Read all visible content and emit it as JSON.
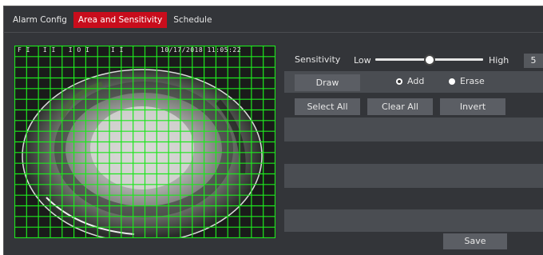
{
  "tabs": [
    {
      "label": "Alarm Config",
      "active": false
    },
    {
      "label": "Area and Sensitivity",
      "active": true
    },
    {
      "label": "Schedule",
      "active": false
    }
  ],
  "video": {
    "osd_left": "F I   I I   I O I     I I",
    "osd_date": "10/17/2018 11:05:22"
  },
  "sensitivity": {
    "label": "Sensitivity",
    "low_label": "Low",
    "high_label": "High",
    "value": "5",
    "level_fraction": 0.5
  },
  "draw": {
    "draw_label": "Draw",
    "add_label": "Add",
    "erase_label": "Erase",
    "mode": "Add"
  },
  "actions": {
    "select_all": "Select All",
    "clear_all": "Clear All",
    "invert": "Invert"
  },
  "save_label": "Save",
  "colors": {
    "active_tab": "#c80d1c",
    "grid": "#1ee61e",
    "panel": "#333539"
  }
}
